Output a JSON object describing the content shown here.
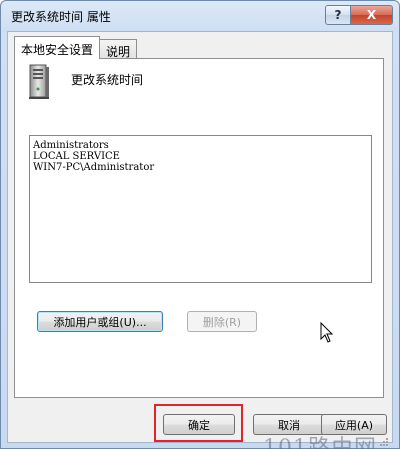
{
  "window": {
    "title": "更改系统时间 属性",
    "help_glyph": "?",
    "close_glyph": "X"
  },
  "tabs": [
    {
      "label": "本地安全设置",
      "active": true
    },
    {
      "label": "说明",
      "active": false
    }
  ],
  "policy": {
    "name": "更改系统时间",
    "icon": "computer-tower-icon"
  },
  "members": [
    "Administrators",
    "LOCAL SERVICE",
    "WIN7-PC\\Administrator"
  ],
  "buttons": {
    "add": "添加用户或组(U)...",
    "remove": "删除(R)",
    "ok": "确定",
    "cancel": "取消",
    "apply": "应用(A)"
  },
  "watermark": "101路由网",
  "colors": {
    "highlight": "#e0242b",
    "close_button": "#c4432b"
  }
}
